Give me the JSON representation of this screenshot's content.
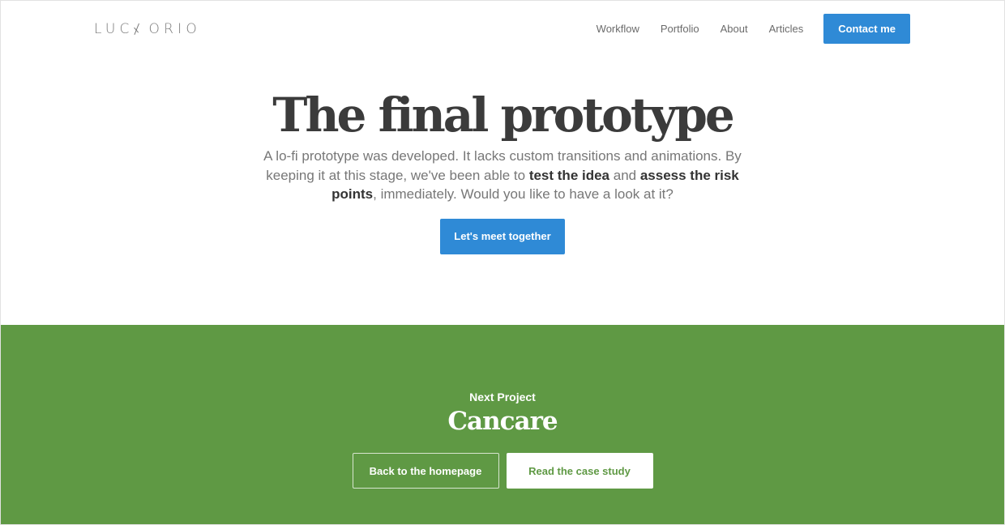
{
  "header": {
    "logo": {
      "before": "LUC",
      "after": "ORIO",
      "full_text": "LUCAORIO"
    },
    "nav": [
      {
        "label": "Workflow"
      },
      {
        "label": "Portfolio"
      },
      {
        "label": "About"
      },
      {
        "label": "Articles"
      }
    ],
    "contact_label": "Contact me"
  },
  "hero": {
    "title": "The final prototype",
    "text": {
      "part1": "A lo-fi prototype was developed. It lacks custom transitions and animations. By keeping it at this stage, we've been able to ",
      "strong1": "test the idea",
      "part2": " and ",
      "strong2": "assess the risk points",
      "part3": ", immediately. Would you like to have a look at it?"
    },
    "cta_label": "Let's meet together"
  },
  "next_project": {
    "label": "Next Project",
    "title": "Cancare",
    "back_label": "Back to the homepage",
    "read_label": "Read the case study"
  },
  "colors": {
    "accent_blue": "#2f8ad6",
    "project_green": "#5f9944",
    "heading_text": "#3b3b3b",
    "body_text": "#777777"
  }
}
